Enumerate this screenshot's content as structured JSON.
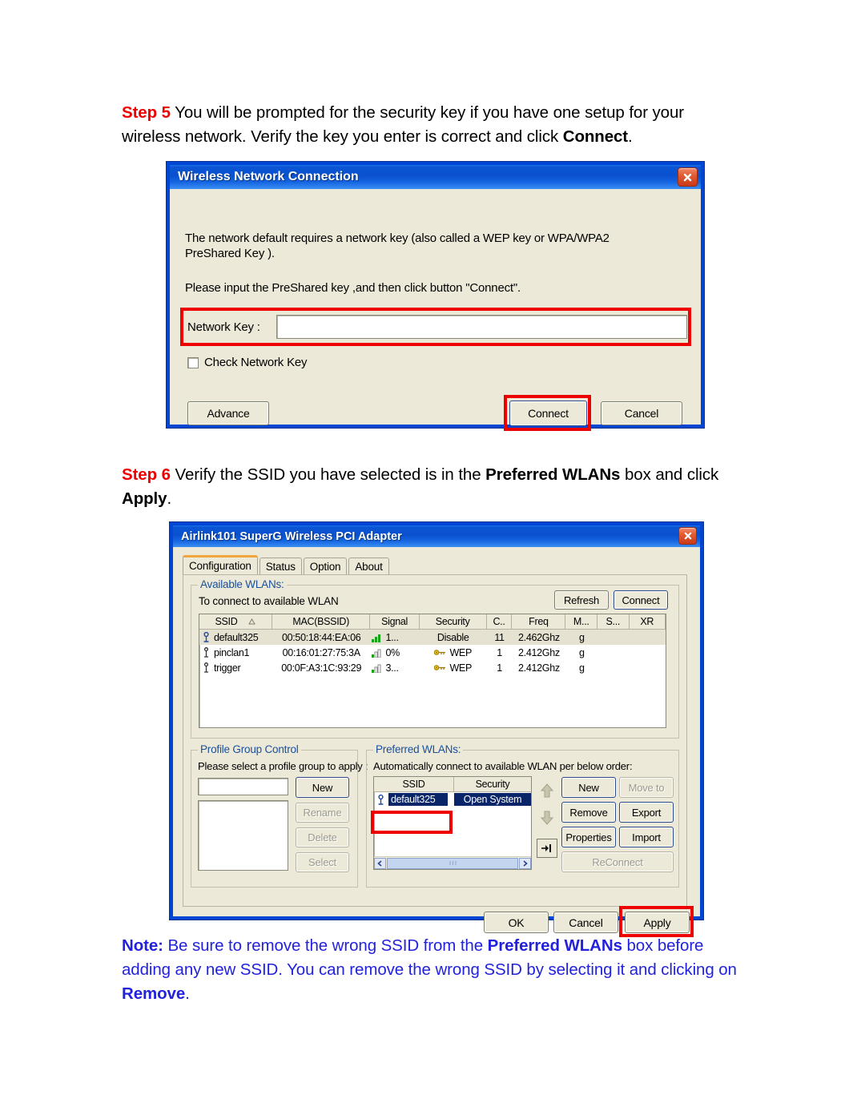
{
  "step5": {
    "label": "Step 5",
    "text_before": " You will be prompted for the security key if you have one setup for your wireless network. Verify the key you enter is correct and click ",
    "bold": "Connect",
    "text_after": "."
  },
  "step6": {
    "label": "Step 6",
    "text_a": " Verify the SSID you have selected is in the ",
    "bold_a": "Preferred WLANs",
    "text_b": " box and click ",
    "bold_b": "Apply",
    "text_c": "."
  },
  "note": {
    "label": "Note:",
    "text_a": " Be sure to remove the wrong SSID from the ",
    "bold_a": "Preferred WLANs",
    "text_b": " box before adding any new SSID. You can remove the wrong SSID by selecting it and clicking on ",
    "bold_b": "Remove",
    "text_c": "."
  },
  "dialog1": {
    "title": "Wireless Network Connection",
    "close_icon": "close-icon",
    "body_line1": "The network default requires a network key (also called a WEP key or WPA/WPA2",
    "body_line2": "PreShared Key ).",
    "body_line3": "Please input the PreShared key ,and then click button \"Connect\".",
    "network_key_label": "Network Key :",
    "network_key_value": "",
    "check_key_label": "Check Network Key",
    "check_key_checked": false,
    "buttons": {
      "advance": "Advance",
      "connect": "Connect",
      "cancel": "Cancel"
    }
  },
  "dialog2": {
    "title": "Airlink101 SuperG Wireless PCI Adapter",
    "close_icon": "close-icon",
    "tabs": [
      {
        "label": "Configuration",
        "active": true
      },
      {
        "label": "Status",
        "active": false
      },
      {
        "label": "Option",
        "active": false
      },
      {
        "label": "About",
        "active": false
      }
    ],
    "available_wlans": {
      "group_label": "Available WLANs:",
      "hint": "To connect to available WLAN",
      "refresh_label": "Refresh",
      "connect_label": "Connect",
      "columns": [
        "SSID",
        "MAC(BSSID)",
        "Signal",
        "Security",
        "C..",
        "Freq",
        "M...",
        "S...",
        "XR"
      ],
      "sort_indicator": "sort-ascending-icon",
      "rows": [
        {
          "icon": "wifi-ap-icon",
          "ssid": "default325",
          "mac": "00:50:18:44:EA:06",
          "signal_icon": "signal-strong-icon",
          "signal": "1...",
          "lock_icon": "",
          "security": "Disable",
          "channel": "11",
          "freq": "2.462Ghz",
          "mode": "g",
          "s": "",
          "xr": "",
          "selected": true
        },
        {
          "icon": "wifi-station-icon",
          "ssid": "pinclan1",
          "mac": "00:16:01:27:75:3A",
          "signal_icon": "signal-weak-icon",
          "signal": "0%",
          "lock_icon": "key-icon",
          "security": "WEP",
          "channel": "1",
          "freq": "2.412Ghz",
          "mode": "g",
          "s": "",
          "xr": "",
          "selected": false
        },
        {
          "icon": "wifi-station-icon",
          "ssid": "trigger",
          "mac": "00:0F:A3:1C:93:29",
          "signal_icon": "signal-weak-icon",
          "signal": "3...",
          "lock_icon": "key-icon",
          "security": "WEP",
          "channel": "1",
          "freq": "2.412Ghz",
          "mode": "g",
          "s": "",
          "xr": "",
          "selected": false
        }
      ]
    },
    "profile_group_control": {
      "group_label": "Profile Group Control",
      "hint": "Please select a profile group to apply :",
      "input_value": "",
      "buttons": [
        {
          "label": "New",
          "disabled": false
        },
        {
          "label": "Rename",
          "disabled": true
        },
        {
          "label": "Delete",
          "disabled": true
        },
        {
          "label": "Select",
          "disabled": true
        }
      ]
    },
    "preferred_wlans": {
      "group_label": "Preferred WLANs:",
      "hint": "Automatically connect to available WLAN per below order:",
      "columns": [
        "SSID",
        "Security"
      ],
      "rows": [
        {
          "icon": "wifi-ap-icon",
          "ssid": "default325",
          "security": "Open System",
          "selected": true
        }
      ],
      "move_up_icon": "arrow-up-icon",
      "move_down_icon": "arrow-down-icon",
      "pin_icon": "pin-icon",
      "scroll_left_icon": "chevron-left-icon",
      "scroll_right_icon": "chevron-right-icon",
      "buttons": [
        {
          "label": "New",
          "disabled": false
        },
        {
          "label": "Move to",
          "disabled": true
        },
        {
          "label": "Remove",
          "disabled": false
        },
        {
          "label": "Export",
          "disabled": false
        },
        {
          "label": "Properties",
          "disabled": false
        },
        {
          "label": "Import",
          "disabled": false
        },
        {
          "label": "ReConnect",
          "disabled": true
        }
      ]
    },
    "footer_buttons": {
      "ok": "OK",
      "cancel": "Cancel",
      "apply": "Apply"
    }
  },
  "colors": {
    "step_red": "#ee0000",
    "note_blue": "#2222dd",
    "highlight_red": "#ee0000",
    "title_blue": "#0b55d4",
    "dialog_face": "#ece9d8",
    "selection_blue": "#0a246a"
  }
}
